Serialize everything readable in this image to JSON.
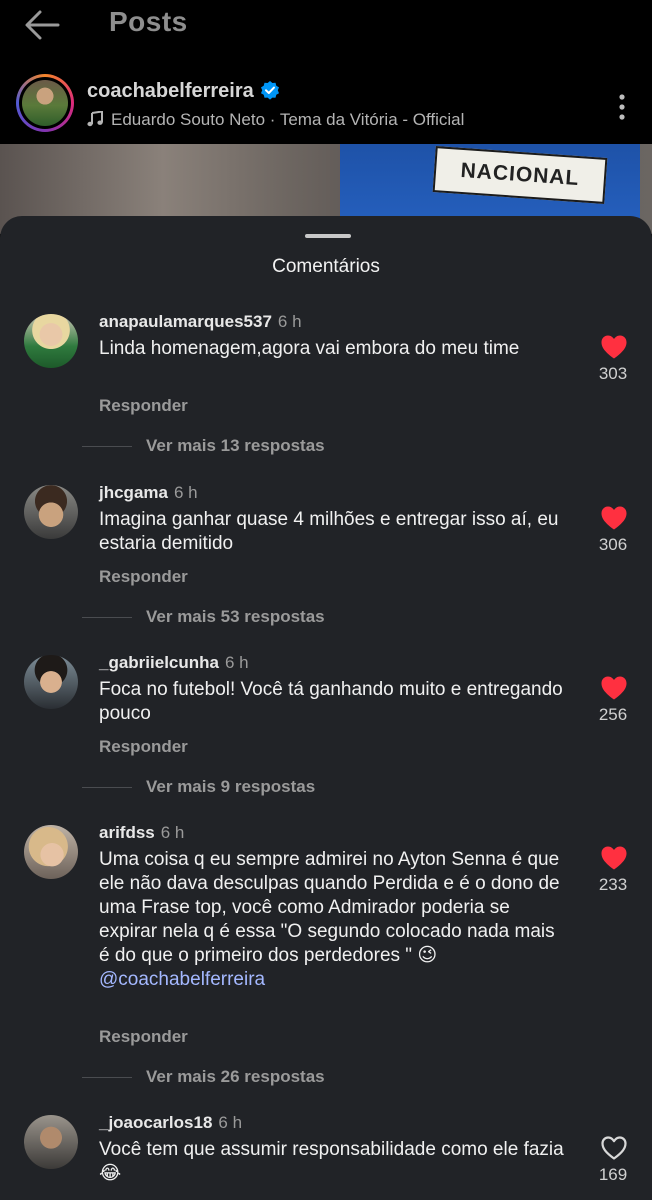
{
  "header": {
    "title": "Posts"
  },
  "post": {
    "username": "coachabelferreira",
    "song": "Eduardo Souto Neto · Tema da Vitória - Official",
    "media_badge_text": "NACIONAL"
  },
  "sheet": {
    "title": "Comentários"
  },
  "comments": [
    {
      "username": "anapaulamarques537",
      "time": "6 h",
      "text": "Linda homenagem,agora vai embora do meu time",
      "reply_label": "Responder",
      "likes": "303",
      "liked": true,
      "view_replies": "Ver mais 13 respostas"
    },
    {
      "username": "jhcgama",
      "time": "6 h",
      "text": "Imagina ganhar quase 4 milhões e entregar isso aí, eu estaria demitido",
      "reply_label": "Responder",
      "likes": "306",
      "liked": true,
      "view_replies": "Ver mais 53 respostas"
    },
    {
      "username": "_gabriielcunha",
      "time": "6 h",
      "text": "Foca no futebol! Você tá ganhando muito e entregando pouco",
      "reply_label": "Responder",
      "likes": "256",
      "liked": true,
      "view_replies": "Ver mais 9 respostas"
    },
    {
      "username": "arifdss",
      "time": "6 h",
      "text": "Uma coisa q eu sempre admirei no Ayton Senna é que ele não dava desculpas quando Perdida e é o dono de uma Frase top, você como Admirador poderia se expirar nela q é essa \"O segundo colocado nada mais é do que o primeiro dos perdedores \" 😉",
      "mention": "@coachabelferreira",
      "reply_label": "Responder",
      "likes": "233",
      "liked": true,
      "view_replies": "Ver mais 26 respostas"
    },
    {
      "username": "_joaocarlos18",
      "time": "6 h",
      "text": "Você tem que assumir responsabilidade como ele fazia 😂",
      "likes": "169",
      "liked": false
    }
  ],
  "colors": {
    "like_red": "#ff3040",
    "mention_blue": "#a4b8ff",
    "sheet_bg": "#212327",
    "verified_blue": "#0095f6"
  }
}
